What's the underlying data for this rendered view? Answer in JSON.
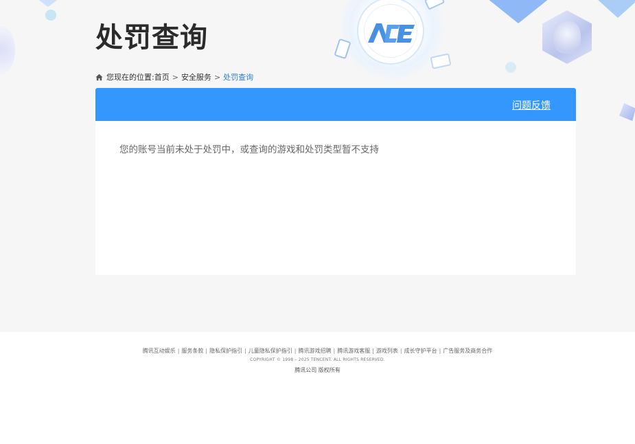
{
  "page": {
    "title": "处罚查询"
  },
  "breadcrumb": {
    "prefix": "您现在的位置:",
    "items": [
      "首页",
      "安全服务",
      "处罚查询"
    ],
    "separator": ">"
  },
  "panel": {
    "feedback_label": "问题反馈",
    "message": "您的账号当前未处于处罚中，或查询的游戏和处罚类型暂不支持"
  },
  "footer": {
    "links": [
      "腾讯互动娱乐",
      "服务条款",
      "隐私保护指引",
      "儿童隐私保护指引",
      "腾讯游戏招聘",
      "腾讯游戏客服",
      "游戏列表",
      "成长守护平台",
      "广告服务及商务合作"
    ],
    "divider": "|",
    "copyright": "COPYRIGHT © 1998 – 2025 TENCENT. ALL RIGHTS RESERVED.",
    "company": "腾讯公司 版权所有"
  },
  "colors": {
    "header_bar": "#3497fe",
    "breadcrumb_current": "#2d7ed8",
    "background": "#f6f6f7"
  },
  "icons": {
    "home": "home-icon",
    "logo": "ace-logo"
  }
}
